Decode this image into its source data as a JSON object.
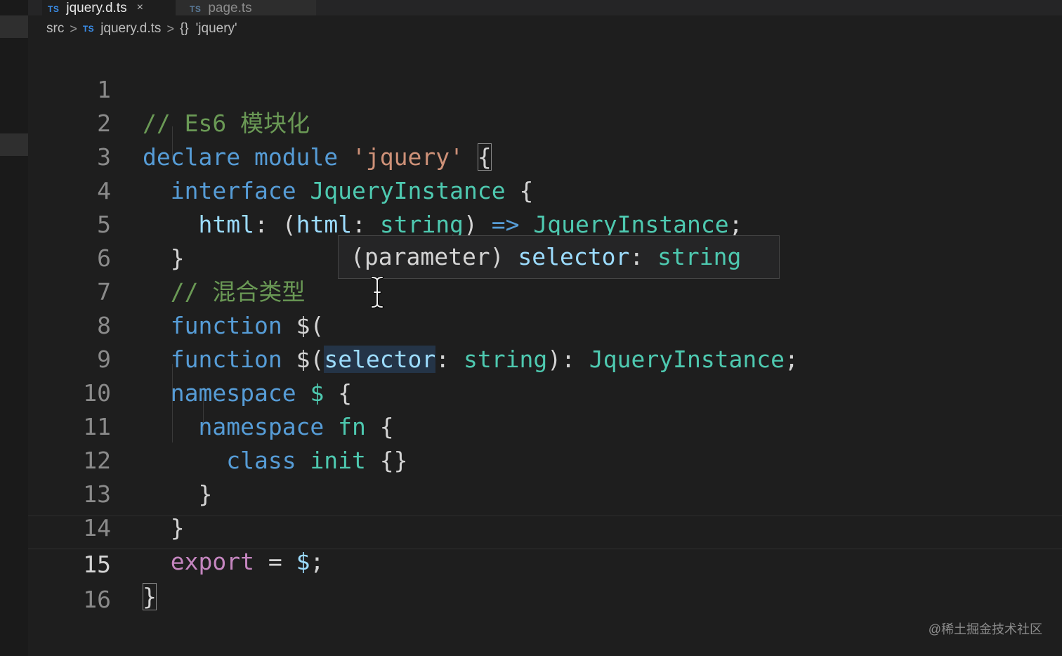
{
  "tabs": [
    {
      "badge": "TS",
      "label": "jquery.d.ts",
      "close": "×"
    },
    {
      "badge": "TS",
      "label": "page.ts"
    }
  ],
  "breadcrumb": {
    "folder": "src",
    "sep": ">",
    "file_badge": "TS",
    "file": "jquery.d.ts",
    "symbol_icon": "{}",
    "symbol": "'jquery'"
  },
  "editor": {
    "language": "typescript",
    "current_line": 15,
    "lines": [
      {
        "num": "1"
      },
      {
        "num": "2"
      },
      {
        "num": "3"
      },
      {
        "num": "4"
      },
      {
        "num": "5"
      },
      {
        "num": "6"
      },
      {
        "num": "7"
      },
      {
        "num": "8"
      },
      {
        "num": "9"
      },
      {
        "num": "10"
      },
      {
        "num": "11"
      },
      {
        "num": "12"
      },
      {
        "num": "13"
      },
      {
        "num": "14"
      },
      {
        "num": "15"
      },
      {
        "num": "16"
      }
    ],
    "tokens": {
      "l1_comment": "// Es6 模块化",
      "l2_declare": "declare",
      "l2_module": "module",
      "l2_name": "'jquery'",
      "l2_brace": "{",
      "l3_interface": "interface",
      "l3_name": "JqueryInstance",
      "l3_brace": "{",
      "l4_prop": "html",
      "l4_colon": ":",
      "l4_open": "(",
      "l4_param": "html",
      "l4_colon2": ":",
      "l4_type": "string",
      "l4_close": ")",
      "l4_arrow": "=>",
      "l4_ret": "JqueryInstance",
      "l4_semi": ";",
      "l5_brace": "}",
      "l6_comment": "// 混合类型",
      "l7_function": "function",
      "l7_name": "$(",
      "l8_function": "function",
      "l8_name": "$(",
      "l8_param": "selector",
      "l8_colon": ":",
      "l8_type": "string",
      "l8_close": "):",
      "l8_ret": "JqueryInstance",
      "l8_semi": ";",
      "l9_namespace": "namespace",
      "l9_name": "$",
      "l9_brace": "{",
      "l10_namespace": "namespace",
      "l10_name": "fn",
      "l10_brace": "{",
      "l11_class": "class",
      "l11_name": "init",
      "l11_body": "{}",
      "l12_brace": "}",
      "l13_brace": "}",
      "l14_export": "export",
      "l14_eq": "=",
      "l14_dollar": "$",
      "l14_semi": ";",
      "l15_brace": "}"
    }
  },
  "hover": {
    "kind": "(parameter)",
    "name": "selector",
    "colon": ":",
    "type": "string"
  },
  "watermark": "@稀土掘金技术社区",
  "colors": {
    "background": "#1e1e1e",
    "keyword": "#569cd6",
    "type": "#4ec9b0",
    "string": "#ce9178",
    "comment": "#6a9955",
    "variable": "#9cdcfe",
    "control": "#c586c0"
  }
}
